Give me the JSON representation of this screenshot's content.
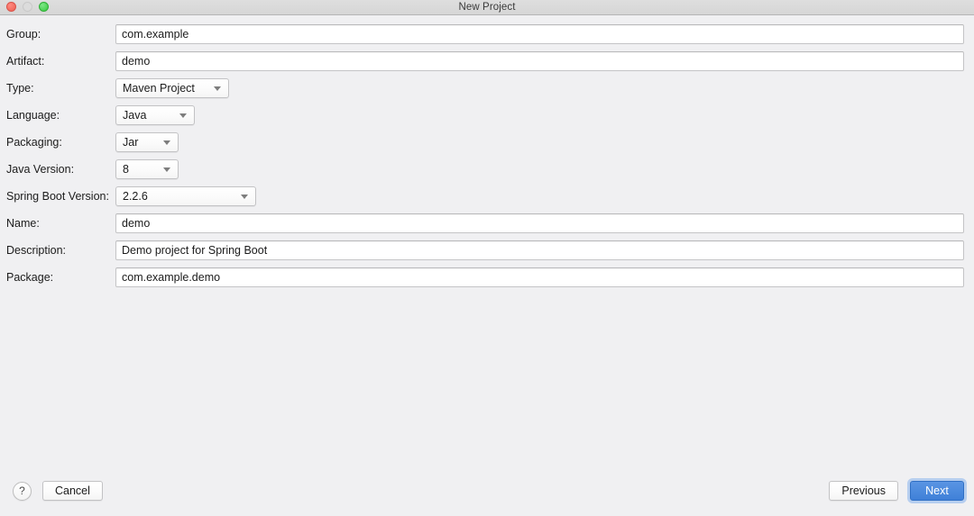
{
  "window": {
    "title": "New Project",
    "traffic_lights": [
      {
        "name": "close",
        "color": "#ee5f52",
        "enabled": true
      },
      {
        "name": "minimize",
        "color": "#dcdcdc",
        "enabled": false
      },
      {
        "name": "maximize",
        "color": "#37c93f",
        "enabled": true
      }
    ]
  },
  "form": {
    "fields": [
      {
        "key": "group",
        "label": "Group:",
        "control": "text",
        "value": "com.example"
      },
      {
        "key": "artifact",
        "label": "Artifact:",
        "control": "text",
        "value": "demo"
      },
      {
        "key": "type",
        "label": "Type:",
        "control": "select",
        "value": "Maven Project"
      },
      {
        "key": "language",
        "label": "Language:",
        "control": "select",
        "value": "Java"
      },
      {
        "key": "packaging",
        "label": "Packaging:",
        "control": "select",
        "value": "Jar"
      },
      {
        "key": "javaver",
        "label": "Java Version:",
        "control": "select",
        "value": "8"
      },
      {
        "key": "springver",
        "label": "Spring Boot Version:",
        "control": "select",
        "value": "2.2.6"
      },
      {
        "key": "name",
        "label": "Name:",
        "control": "text",
        "value": "demo"
      },
      {
        "key": "desc",
        "label": "Description:",
        "control": "text",
        "value": "Demo project for Spring Boot"
      },
      {
        "key": "package",
        "label": "Package:",
        "control": "text",
        "value": "com.example.demo"
      }
    ]
  },
  "footer": {
    "help_label": "?",
    "cancel_label": "Cancel",
    "previous_label": "Previous",
    "next_label": "Next",
    "next_accent_color": "#3f80d8"
  }
}
